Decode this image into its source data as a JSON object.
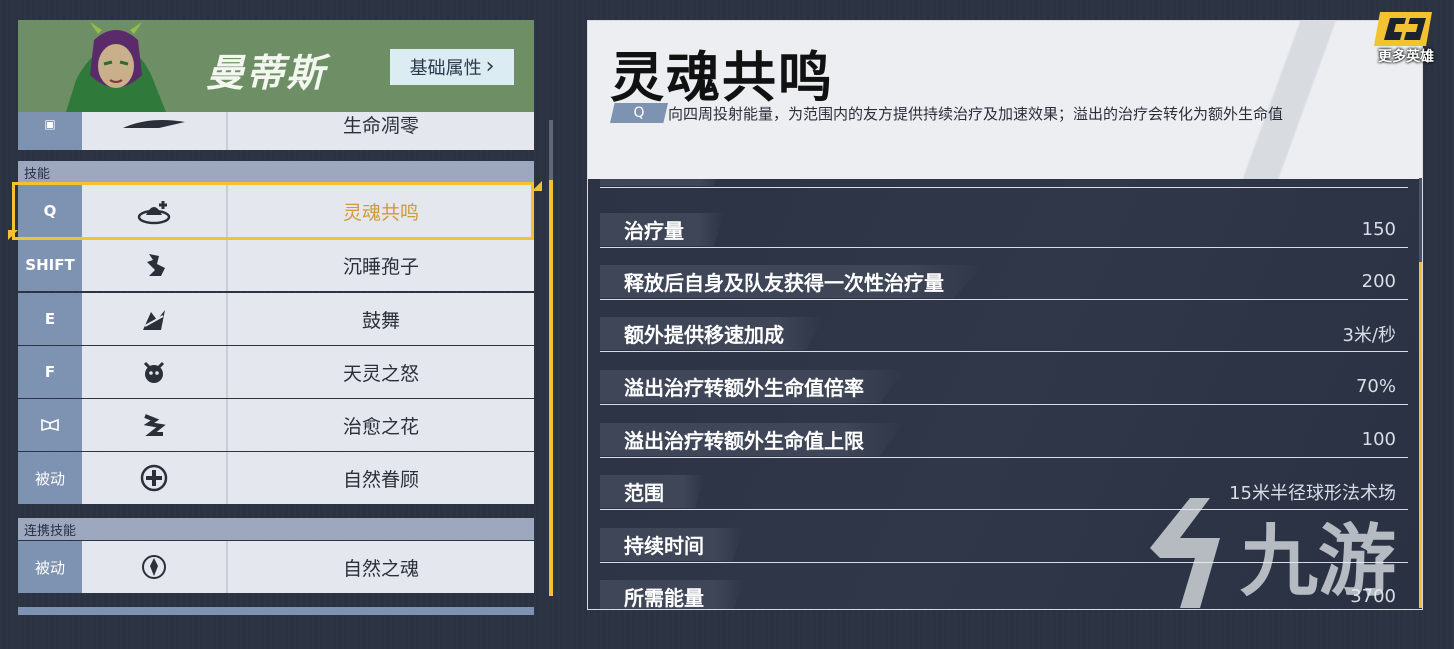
{
  "hero": {
    "name": "曼蒂斯",
    "base_attr_label": "基础属性",
    "base_attr_arrow": "›"
  },
  "skills_list": {
    "partial_top_row": {
      "key": "",
      "name": "生命凋零"
    },
    "section_skills": "技能",
    "skills": [
      {
        "key": "Q",
        "name": "灵魂共鸣",
        "icon": "soul-resonance-icon",
        "active": true
      },
      {
        "key": "SHIFT",
        "name": "沉睡孢子",
        "icon": "sleep-spore-icon"
      },
      {
        "key": "E",
        "name": "鼓舞",
        "icon": "inspire-icon"
      },
      {
        "key": "F",
        "name": "天灵之怒",
        "icon": "spirit-wrath-icon"
      },
      {
        "key": "",
        "name": "治愈之花",
        "icon": "healing-flower-icon"
      },
      {
        "key": "被动",
        "name": "自然眷顾",
        "icon": "nature-favor-icon"
      }
    ],
    "section_team": "连携技能",
    "team_skills": [
      {
        "key": "被动",
        "name": "自然之魂",
        "icon": "nature-soul-icon"
      }
    ]
  },
  "detail": {
    "title": "灵魂共鸣",
    "key_tag": "Q",
    "description": "向四周投射能量，为范围内的友方提供持续治疗及加速效果；溢出的治疗会转化为额外生命值",
    "stats": [
      {
        "label": "治疗量",
        "value": "150"
      },
      {
        "label": "释放后自身及队友获得一次性治疗量",
        "value": "200"
      },
      {
        "label": "额外提供移速加成",
        "value": "3米/秒"
      },
      {
        "label": "溢出治疗转额外生命值倍率",
        "value": "70%"
      },
      {
        "label": "溢出治疗转额外生命值上限",
        "value": "100"
      },
      {
        "label": "范围",
        "value": "15米半径球形法术场"
      },
      {
        "label": "持续时间",
        "value": ""
      },
      {
        "label": "所需能量",
        "value": "3700"
      }
    ]
  },
  "branding": {
    "more_heroes": "更多英雄",
    "watermark": "九游"
  },
  "colors": {
    "accent": "#f2c230",
    "key_cell": "#7e92b1",
    "hero_header": "#6e8f65",
    "active_text": "#cf9a3a"
  }
}
